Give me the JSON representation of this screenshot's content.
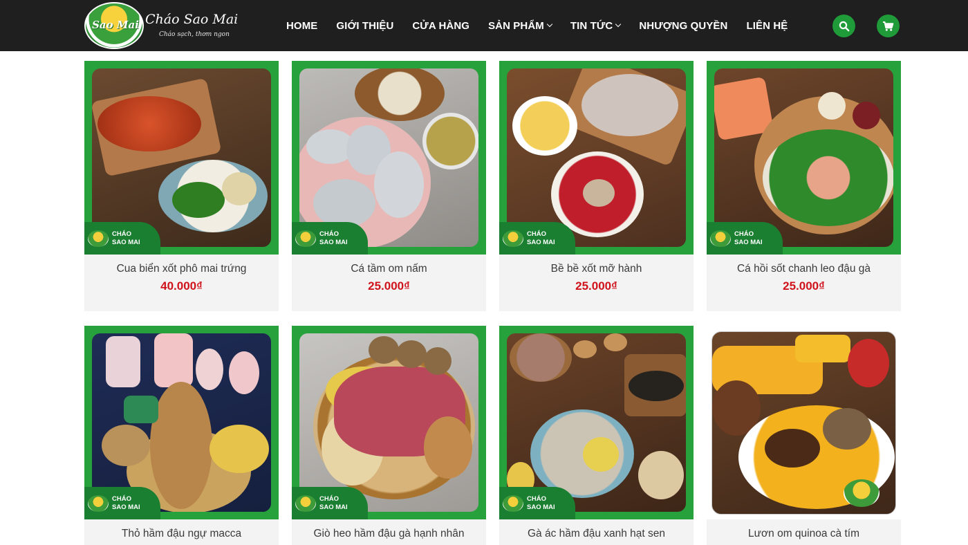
{
  "header": {
    "logo": {
      "badge_text": "Sao Mai",
      "title": "Cháo Sao Mai",
      "slogan": "Cháo sạch, thơm ngon"
    },
    "nav": [
      {
        "label": "HOME",
        "has_dropdown": false
      },
      {
        "label": "GIỚI THIỆU",
        "has_dropdown": false
      },
      {
        "label": "CỬA HÀNG",
        "has_dropdown": false
      },
      {
        "label": "SẢN PHẨM",
        "has_dropdown": true
      },
      {
        "label": "TIN TỨC",
        "has_dropdown": true
      },
      {
        "label": "NHƯỢNG QUYỀN",
        "has_dropdown": false
      },
      {
        "label": "LIÊN HỆ",
        "has_dropdown": false
      }
    ],
    "search_icon": "search-icon",
    "cart_icon": "cart-icon"
  },
  "brand_tag": {
    "line1": "CHÁO",
    "line2": "SAO MAI"
  },
  "products": [
    {
      "name": "Cua biển xốt phô mai trứng",
      "price": "40.000₫"
    },
    {
      "name": "Cá tầm om nấm",
      "price": "25.000₫"
    },
    {
      "name": "Bề bề xốt mỡ hành",
      "price": "25.000₫"
    },
    {
      "name": "Cá hồi sốt chanh leo đậu gà",
      "price": "25.000₫"
    },
    {
      "name": "Thỏ hầm đậu ngự macca",
      "price": ""
    },
    {
      "name": "Giò heo hầm đậu gà hạnh nhân",
      "price": ""
    },
    {
      "name": "Gà ác hầm đậu xanh hạt sen",
      "price": ""
    },
    {
      "name": "Lươn om quinoa cà tím",
      "price": ""
    }
  ],
  "theme": {
    "accent": "#27a13c",
    "header_bg": "#1f1f1f",
    "price_color": "#d0121b"
  }
}
